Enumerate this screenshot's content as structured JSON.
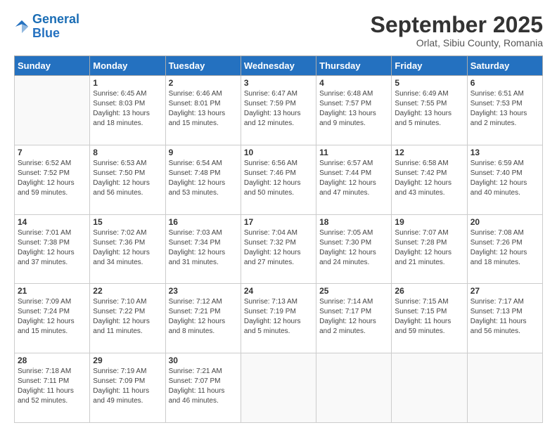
{
  "logo": {
    "line1": "General",
    "line2": "Blue"
  },
  "header": {
    "month": "September 2025",
    "location": "Orlat, Sibiu County, Romania"
  },
  "weekdays": [
    "Sunday",
    "Monday",
    "Tuesday",
    "Wednesday",
    "Thursday",
    "Friday",
    "Saturday"
  ],
  "weeks": [
    [
      {
        "day": "",
        "sunrise": "",
        "sunset": "",
        "daylight": ""
      },
      {
        "day": "1",
        "sunrise": "Sunrise: 6:45 AM",
        "sunset": "Sunset: 8:03 PM",
        "daylight": "Daylight: 13 hours and 18 minutes."
      },
      {
        "day": "2",
        "sunrise": "Sunrise: 6:46 AM",
        "sunset": "Sunset: 8:01 PM",
        "daylight": "Daylight: 13 hours and 15 minutes."
      },
      {
        "day": "3",
        "sunrise": "Sunrise: 6:47 AM",
        "sunset": "Sunset: 7:59 PM",
        "daylight": "Daylight: 13 hours and 12 minutes."
      },
      {
        "day": "4",
        "sunrise": "Sunrise: 6:48 AM",
        "sunset": "Sunset: 7:57 PM",
        "daylight": "Daylight: 13 hours and 9 minutes."
      },
      {
        "day": "5",
        "sunrise": "Sunrise: 6:49 AM",
        "sunset": "Sunset: 7:55 PM",
        "daylight": "Daylight: 13 hours and 5 minutes."
      },
      {
        "day": "6",
        "sunrise": "Sunrise: 6:51 AM",
        "sunset": "Sunset: 7:53 PM",
        "daylight": "Daylight: 13 hours and 2 minutes."
      }
    ],
    [
      {
        "day": "7",
        "sunrise": "Sunrise: 6:52 AM",
        "sunset": "Sunset: 7:52 PM",
        "daylight": "Daylight: 12 hours and 59 minutes."
      },
      {
        "day": "8",
        "sunrise": "Sunrise: 6:53 AM",
        "sunset": "Sunset: 7:50 PM",
        "daylight": "Daylight: 12 hours and 56 minutes."
      },
      {
        "day": "9",
        "sunrise": "Sunrise: 6:54 AM",
        "sunset": "Sunset: 7:48 PM",
        "daylight": "Daylight: 12 hours and 53 minutes."
      },
      {
        "day": "10",
        "sunrise": "Sunrise: 6:56 AM",
        "sunset": "Sunset: 7:46 PM",
        "daylight": "Daylight: 12 hours and 50 minutes."
      },
      {
        "day": "11",
        "sunrise": "Sunrise: 6:57 AM",
        "sunset": "Sunset: 7:44 PM",
        "daylight": "Daylight: 12 hours and 47 minutes."
      },
      {
        "day": "12",
        "sunrise": "Sunrise: 6:58 AM",
        "sunset": "Sunset: 7:42 PM",
        "daylight": "Daylight: 12 hours and 43 minutes."
      },
      {
        "day": "13",
        "sunrise": "Sunrise: 6:59 AM",
        "sunset": "Sunset: 7:40 PM",
        "daylight": "Daylight: 12 hours and 40 minutes."
      }
    ],
    [
      {
        "day": "14",
        "sunrise": "Sunrise: 7:01 AM",
        "sunset": "Sunset: 7:38 PM",
        "daylight": "Daylight: 12 hours and 37 minutes."
      },
      {
        "day": "15",
        "sunrise": "Sunrise: 7:02 AM",
        "sunset": "Sunset: 7:36 PM",
        "daylight": "Daylight: 12 hours and 34 minutes."
      },
      {
        "day": "16",
        "sunrise": "Sunrise: 7:03 AM",
        "sunset": "Sunset: 7:34 PM",
        "daylight": "Daylight: 12 hours and 31 minutes."
      },
      {
        "day": "17",
        "sunrise": "Sunrise: 7:04 AM",
        "sunset": "Sunset: 7:32 PM",
        "daylight": "Daylight: 12 hours and 27 minutes."
      },
      {
        "day": "18",
        "sunrise": "Sunrise: 7:05 AM",
        "sunset": "Sunset: 7:30 PM",
        "daylight": "Daylight: 12 hours and 24 minutes."
      },
      {
        "day": "19",
        "sunrise": "Sunrise: 7:07 AM",
        "sunset": "Sunset: 7:28 PM",
        "daylight": "Daylight: 12 hours and 21 minutes."
      },
      {
        "day": "20",
        "sunrise": "Sunrise: 7:08 AM",
        "sunset": "Sunset: 7:26 PM",
        "daylight": "Daylight: 12 hours and 18 minutes."
      }
    ],
    [
      {
        "day": "21",
        "sunrise": "Sunrise: 7:09 AM",
        "sunset": "Sunset: 7:24 PM",
        "daylight": "Daylight: 12 hours and 15 minutes."
      },
      {
        "day": "22",
        "sunrise": "Sunrise: 7:10 AM",
        "sunset": "Sunset: 7:22 PM",
        "daylight": "Daylight: 12 hours and 11 minutes."
      },
      {
        "day": "23",
        "sunrise": "Sunrise: 7:12 AM",
        "sunset": "Sunset: 7:21 PM",
        "daylight": "Daylight: 12 hours and 8 minutes."
      },
      {
        "day": "24",
        "sunrise": "Sunrise: 7:13 AM",
        "sunset": "Sunset: 7:19 PM",
        "daylight": "Daylight: 12 hours and 5 minutes."
      },
      {
        "day": "25",
        "sunrise": "Sunrise: 7:14 AM",
        "sunset": "Sunset: 7:17 PM",
        "daylight": "Daylight: 12 hours and 2 minutes."
      },
      {
        "day": "26",
        "sunrise": "Sunrise: 7:15 AM",
        "sunset": "Sunset: 7:15 PM",
        "daylight": "Daylight: 11 hours and 59 minutes."
      },
      {
        "day": "27",
        "sunrise": "Sunrise: 7:17 AM",
        "sunset": "Sunset: 7:13 PM",
        "daylight": "Daylight: 11 hours and 56 minutes."
      }
    ],
    [
      {
        "day": "28",
        "sunrise": "Sunrise: 7:18 AM",
        "sunset": "Sunset: 7:11 PM",
        "daylight": "Daylight: 11 hours and 52 minutes."
      },
      {
        "day": "29",
        "sunrise": "Sunrise: 7:19 AM",
        "sunset": "Sunset: 7:09 PM",
        "daylight": "Daylight: 11 hours and 49 minutes."
      },
      {
        "day": "30",
        "sunrise": "Sunrise: 7:21 AM",
        "sunset": "Sunset: 7:07 PM",
        "daylight": "Daylight: 11 hours and 46 minutes."
      },
      {
        "day": "",
        "sunrise": "",
        "sunset": "",
        "daylight": ""
      },
      {
        "day": "",
        "sunrise": "",
        "sunset": "",
        "daylight": ""
      },
      {
        "day": "",
        "sunrise": "",
        "sunset": "",
        "daylight": ""
      },
      {
        "day": "",
        "sunrise": "",
        "sunset": "",
        "daylight": ""
      }
    ]
  ]
}
